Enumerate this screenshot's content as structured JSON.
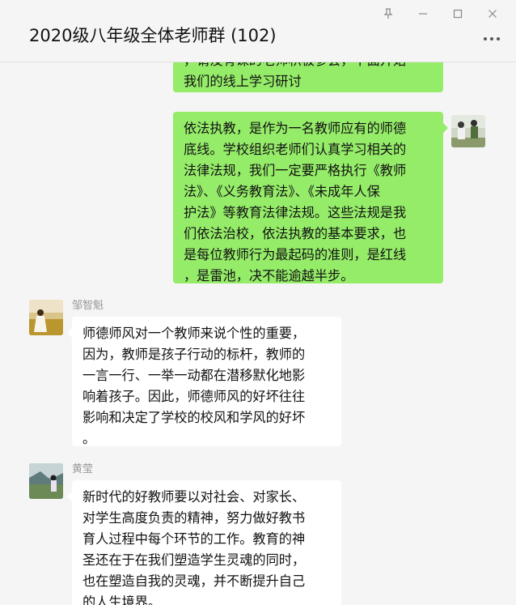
{
  "window": {
    "title": "2020级八年级全体老师群 (102)",
    "controls": {
      "pin_icon": "pin-icon",
      "minimize_icon": "minimize-icon",
      "maximize_icon": "maximize-icon",
      "close_icon": "close-icon"
    }
  },
  "colors": {
    "self_bubble": "#95ec69",
    "other_bubble": "#ffffff",
    "background": "#f5f5f5"
  },
  "messages": [
    {
      "sender": "self",
      "text": "，请没有课的老师积极参会，下面开始\n我们的线上学习研讨"
    },
    {
      "sender": "self",
      "text": "依法执教，是作为一名教师应有的师德\n底线。学校组织老师们认真学习相关的\n法律法规，我们一定要严格执行《教师\n法》、《义务教育法》、《未成年人保\n护法》等教育法律法规。这些法规是我\n们依法治校，依法执教的基本要求，也\n是每位教师行为最起码的准则，是红线\n，是雷池，决不能逾越半步。"
    },
    {
      "sender": "邹智魁",
      "text": "师德师风对一个教师来说个性的重要，\n因为，教师是孩子行动的标杆，教师的\n一言一行、一举一动都在潜移默化地影\n响着孩子。因此，师德师风的好坏往往\n影响和决定了学校的校风和学风的好坏\n。"
    },
    {
      "sender": "黄莹",
      "text": "新时代的好教师要以对社会、对家长、\n对学生高度负责的精神，努力做好教书\n育人过程中每个环节的工作。教育的神\n圣还在于在我们塑造学生灵魂的同时，\n也在塑造自我的灵魂，并不断提升自己\n的人生境界。"
    }
  ]
}
